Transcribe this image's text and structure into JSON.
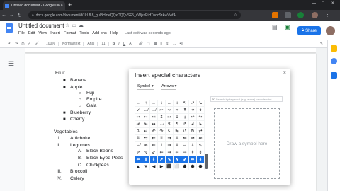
{
  "browser": {
    "tab_title": "Untitled document - Google Do...",
    "tab_close": "×",
    "new_tab": "+",
    "url": "docs.google.com/document/d/1kLfL8_gulBHmeQQxDQQvSF5_cWjsxPiHTndcSrAwVwfA",
    "window_controls": [
      "—",
      "□",
      "×"
    ]
  },
  "docs": {
    "title": "Untitled document",
    "menu": [
      "File",
      "Edit",
      "View",
      "Insert",
      "Format",
      "Tools",
      "Add-ons",
      "Help"
    ],
    "last_edit": "Last edit was seconds ago",
    "share_label": "Share"
  },
  "toolbar": {
    "zoom": "100%",
    "style": "Normal text",
    "font": "Arial",
    "size": "11",
    "bold": "B",
    "italic": "I",
    "underline": "U",
    "text_color": "A"
  },
  "document": {
    "lines": [
      {
        "text": "Fruit",
        "bullet": ""
      },
      {
        "text": "Banana",
        "bullet": "■"
      },
      {
        "text": "Apple",
        "bullet": "■"
      },
      {
        "text": "Fuji",
        "bullet": "○"
      },
      {
        "text": "Empire",
        "bullet": "○"
      },
      {
        "text": "Gala",
        "bullet": "○"
      },
      {
        "text": "Blueberry",
        "bullet": "■"
      },
      {
        "text": "Cherry",
        "bullet": "■"
      },
      {
        "text": "Vegetables",
        "bullet": ""
      },
      {
        "text": "Artichoke",
        "bullet": "I."
      },
      {
        "text": "Legumes",
        "bullet": "II."
      },
      {
        "text": "Black Beans",
        "bullet": "A."
      },
      {
        "text": "Black Eyed Peas",
        "bullet": "B."
      },
      {
        "text": "Chickpeas",
        "bullet": "C."
      },
      {
        "text": "Broccoli",
        "bullet": "III."
      },
      {
        "text": "Celery",
        "bullet": "IV."
      }
    ]
  },
  "dialog": {
    "title": "Insert special characters",
    "close": "×",
    "category": "Symbol",
    "subcategory": "Arrows",
    "search_placeholder": "Search by keyword (e.g. arrow) or codepoint",
    "draw_hint": "Draw a symbol here",
    "symbols": [
      "←",
      "↑",
      "→",
      "↓",
      "↔",
      "↕",
      "↖",
      "↗",
      "↘",
      "↙",
      "↚",
      "↛",
      "↜",
      "↝",
      "↞",
      "↟",
      "↠",
      "↡",
      "↢",
      "↣",
      "↤",
      "↥",
      "↦",
      "↧",
      "↨",
      "↩",
      "↪",
      "↫",
      "↬",
      "↭",
      "↮",
      "↯",
      "↰",
      "↱",
      "↲",
      "↳",
      "↴",
      "↵",
      "↶",
      "↷",
      "↸",
      "↹",
      "↺",
      "↻",
      "⇄",
      "⇅",
      "⇆",
      "⇇",
      "⇈",
      "⇉",
      "⇊",
      "⇋",
      "⇌",
      "⇍",
      "⇎",
      "⇏",
      "⇐",
      "⇑",
      "⇒",
      "⇓",
      "⇔",
      "⇕",
      "⇖",
      "⇗",
      "⇘",
      "⇙",
      "⇚",
      "⇛",
      "⇜",
      "⇝",
      "⇞",
      "⇟",
      "⬅",
      "⬆",
      "⬇",
      "⬈",
      "⬉",
      "⬊",
      "⬋",
      "⬌",
      "⬍",
      "▲",
      "▼",
      "◀",
      "▶",
      "⬛",
      "⬜",
      "⬟",
      "⬢",
      "⬣"
    ]
  }
}
